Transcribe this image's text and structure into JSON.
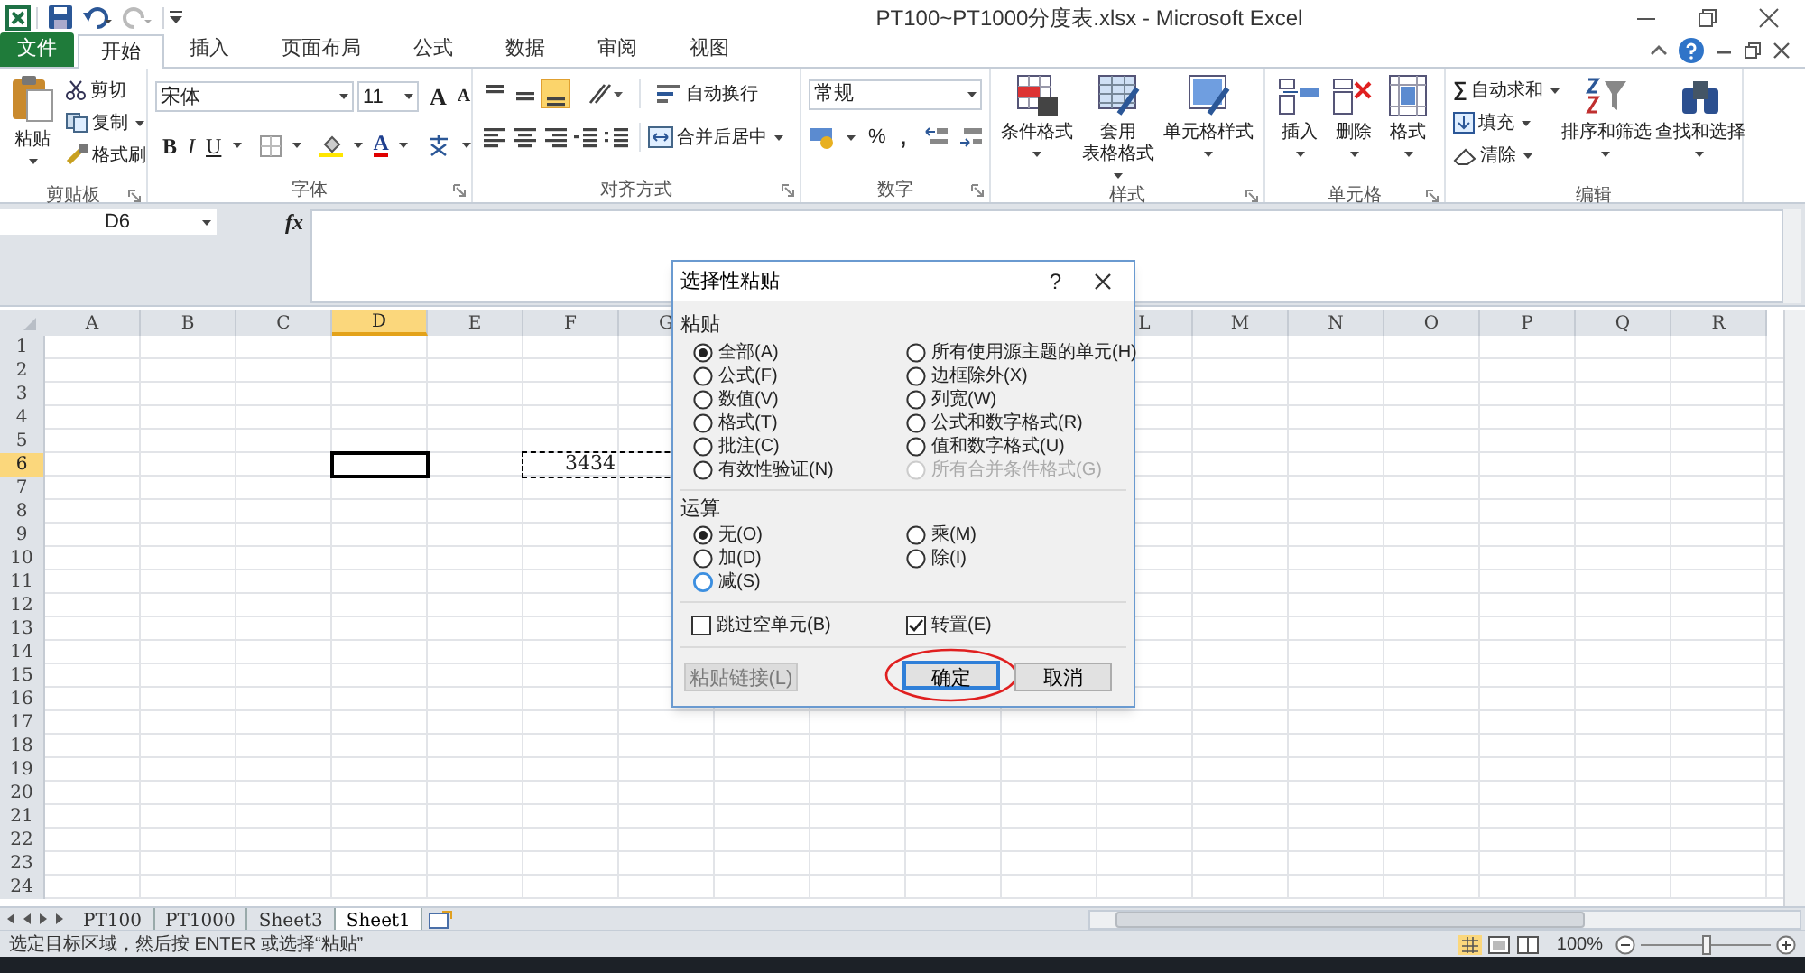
{
  "window": {
    "title": "PT100~PT1000分度表.xlsx - Microsoft Excel"
  },
  "tabs": [
    {
      "label": "文件",
      "kind": "file",
      "selected": false
    },
    {
      "label": "开始",
      "kind": "tab",
      "selected": true
    },
    {
      "label": "插入",
      "kind": "tab",
      "selected": false
    },
    {
      "label": "页面布局",
      "kind": "tab",
      "selected": false
    },
    {
      "label": "公式",
      "kind": "tab",
      "selected": false
    },
    {
      "label": "数据",
      "kind": "tab",
      "selected": false
    },
    {
      "label": "审阅",
      "kind": "tab",
      "selected": false
    },
    {
      "label": "视图",
      "kind": "tab",
      "selected": false
    }
  ],
  "ribbon": {
    "clipboard": {
      "label": "剪贴板",
      "paste": "粘贴",
      "cut": "剪切",
      "copy": "复制",
      "format_painter": "格式刷"
    },
    "font": {
      "label": "字体",
      "font_name": "宋体",
      "font_size": "11",
      "grow": "A",
      "shrink": "A",
      "bold": "B",
      "italic": "I",
      "underline": "U",
      "font_color": "A"
    },
    "alignment": {
      "label": "对齐方式",
      "wrap_text": "自动换行",
      "merge_center": "合并后居中"
    },
    "number": {
      "label": "数字",
      "format": "常规",
      "percent": "%",
      "comma": ","
    },
    "styles": {
      "label": "样式",
      "conditional": "条件格式",
      "table_format_1": "套用",
      "table_format_2": "表格格式",
      "cell_styles": "单元格样式"
    },
    "cells": {
      "label": "单元格",
      "insert": "插入",
      "delete": "删除",
      "format": "格式"
    },
    "editing": {
      "label": "编辑",
      "sum_symbol": "∑",
      "autosum": "自动求和",
      "fill": "填充",
      "clear": "清除",
      "sort_filter": "排序和筛选",
      "find_select": "查找和选择"
    }
  },
  "formula_bar": {
    "name_box": "D6",
    "function_label": "fx"
  },
  "grid": {
    "columns": [
      {
        "label": "A",
        "selected": false
      },
      {
        "label": "B",
        "selected": false
      },
      {
        "label": "C",
        "selected": false
      },
      {
        "label": "D",
        "selected": true
      },
      {
        "label": "E",
        "selected": false
      },
      {
        "label": "F",
        "selected": false
      },
      {
        "label": "G",
        "selected": false
      },
      {
        "label": "L",
        "selected": false
      },
      {
        "label": "M",
        "selected": false
      },
      {
        "label": "N",
        "selected": false
      },
      {
        "label": "O",
        "selected": false
      },
      {
        "label": "P",
        "selected": false
      },
      {
        "label": "Q",
        "selected": false
      },
      {
        "label": "R",
        "selected": false
      }
    ],
    "rows": [
      {
        "label": "1",
        "selected": false
      },
      {
        "label": "2",
        "selected": false
      },
      {
        "label": "3",
        "selected": false
      },
      {
        "label": "4",
        "selected": false
      },
      {
        "label": "5",
        "selected": false
      },
      {
        "label": "6",
        "selected": true,
        "cells": [
          {
            "kind": "empty"
          },
          {
            "kind": "empty"
          },
          {
            "kind": "empty"
          },
          {
            "kind": "active"
          },
          {
            "kind": "empty"
          },
          {
            "kind": "copied",
            "value": "3434"
          }
        ]
      },
      {
        "label": "7",
        "selected": false
      },
      {
        "label": "8",
        "selected": false
      },
      {
        "label": "9",
        "selected": false
      },
      {
        "label": "10",
        "selected": false
      },
      {
        "label": "11",
        "selected": false
      },
      {
        "label": "12",
        "selected": false
      },
      {
        "label": "13",
        "selected": false
      },
      {
        "label": "14",
        "selected": false
      },
      {
        "label": "15",
        "selected": false
      },
      {
        "label": "16",
        "selected": false
      },
      {
        "label": "17",
        "selected": false
      },
      {
        "label": "18",
        "selected": false
      },
      {
        "label": "19",
        "selected": false
      },
      {
        "label": "20",
        "selected": false
      },
      {
        "label": "21",
        "selected": false
      },
      {
        "label": "22",
        "selected": false
      },
      {
        "label": "23",
        "selected": false
      },
      {
        "label": "24",
        "selected": false
      }
    ]
  },
  "dialog": {
    "title": "选择性粘贴",
    "help": "?",
    "sections": [
      {
        "label": "粘贴",
        "options": [
          {
            "label": "全部(A)",
            "selected": true,
            "disabled": false,
            "focused": false
          },
          {
            "label": "所有使用源主题的单元(H)",
            "selected": false,
            "disabled": false,
            "focused": false
          },
          {
            "label": "公式(F)",
            "selected": false,
            "disabled": false,
            "focused": false
          },
          {
            "label": "边框除外(X)",
            "selected": false,
            "disabled": false,
            "focused": false
          },
          {
            "label": "数值(V)",
            "selected": false,
            "disabled": false,
            "focused": false
          },
          {
            "label": "列宽(W)",
            "selected": false,
            "disabled": false,
            "focused": false
          },
          {
            "label": "格式(T)",
            "selected": false,
            "disabled": false,
            "focused": false
          },
          {
            "label": "公式和数字格式(R)",
            "selected": false,
            "disabled": false,
            "focused": false
          },
          {
            "label": "批注(C)",
            "selected": false,
            "disabled": false,
            "focused": false
          },
          {
            "label": "值和数字格式(U)",
            "selected": false,
            "disabled": false,
            "focused": false
          },
          {
            "label": "有效性验证(N)",
            "selected": false,
            "disabled": false,
            "focused": false
          },
          {
            "label": "所有合并条件格式(G)",
            "selected": false,
            "disabled": true,
            "focused": false
          }
        ]
      },
      {
        "label": "运算",
        "options": [
          {
            "label": "无(O)",
            "selected": true,
            "disabled": false,
            "focused": false
          },
          {
            "label": "乘(M)",
            "selected": false,
            "disabled": false,
            "focused": false
          },
          {
            "label": "加(D)",
            "selected": false,
            "disabled": false,
            "focused": false
          },
          {
            "label": "除(I)",
            "selected": false,
            "disabled": false,
            "focused": false
          },
          {
            "label": "减(S)",
            "selected": false,
            "disabled": false,
            "focused": true
          }
        ]
      }
    ],
    "checkboxes": [
      {
        "label": "跳过空单元(B)",
        "checked": false
      },
      {
        "label": "转置(E)",
        "checked": true
      }
    ],
    "buttons": [
      {
        "label": "粘贴链接(L)",
        "disabled": true,
        "default": false,
        "circled": false
      },
      {
        "label": "确定",
        "disabled": false,
        "default": true,
        "circled": true
      },
      {
        "label": "取消",
        "disabled": false,
        "default": false,
        "circled": false
      }
    ]
  },
  "sheet_tabs": [
    {
      "label": "PT100",
      "selected": false
    },
    {
      "label": "PT1000",
      "selected": false
    },
    {
      "label": "Sheet3",
      "selected": false
    },
    {
      "label": "Sheet1",
      "selected": true
    }
  ],
  "status_bar": {
    "message": "选定目标区域，然后按 ENTER 或选择“粘贴”",
    "zoom": "100%",
    "zoom_slider": {
      "level": 0.5
    }
  }
}
